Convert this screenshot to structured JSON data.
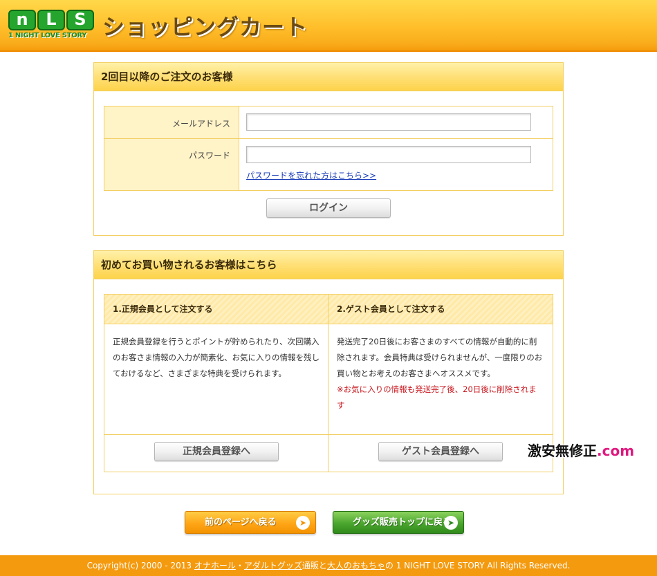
{
  "header": {
    "logo_mark": [
      "n",
      "L",
      "S"
    ],
    "logo_sub": "1 NIGHT LOVE STORY",
    "title": "ショッピングカート"
  },
  "returning": {
    "title": "2回目以降のご注文のお客様",
    "email_label": "メールアドレス",
    "email_value": "",
    "password_label": "パスワード",
    "password_value": "",
    "forgot_link": "パスワードを忘れた方はこちら>>",
    "login_button": "ログイン"
  },
  "first_time": {
    "title": "初めてお買い物されるお客様はこちら",
    "member": {
      "heading": "1.正規会員として注文する",
      "text": "正規会員登録を行うとポイントが貯められたり、次回購入のお客さま情報の入力が簡素化、お気に入りの情報を残しておけるなど、さまざまな特典を受けられます。",
      "button": "正規会員登録へ"
    },
    "guest": {
      "heading": "2.ゲスト会員として注文する",
      "text": "発送完了20日後にお客さまのすべての情報が自動的に削除されます。会員特典は受けられませんが、一度限りのお買い物とお考えのお客さまへオススメです。",
      "warning": "※お気に入りの情報も発送完了後、20日後に削除されます",
      "button": "ゲスト会員登録へ"
    }
  },
  "watermark": {
    "text": "激安無修正",
    "domain": ".com"
  },
  "nav": {
    "back": "前のページへ戻る",
    "top": "グッズ販売トップに戻る"
  },
  "footer": {
    "prefix": "Copyright(c) 2000 - 2013 ",
    "link1": "オナホール",
    "sep1": "・",
    "link2": "アダルトグッズ",
    "mid": "通販と",
    "link3": "大人のおもちゃ",
    "suffix": "の 1 NIGHT LOVE STORY  All Rights Reserved."
  }
}
